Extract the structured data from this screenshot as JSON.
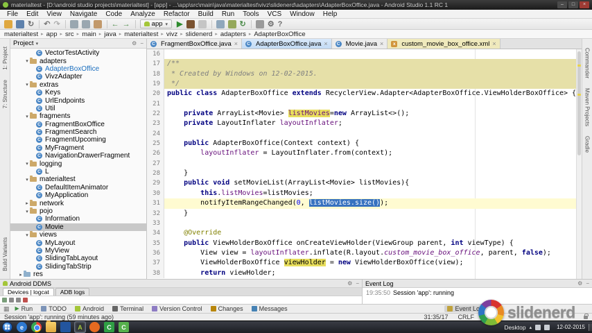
{
  "window": {
    "title": "materialtest - [D:\\android studio projects\\materialtest] - [app] - ...\\app\\src\\main\\java\\materialtest\\vivz\\slidenerd\\adapters\\AdapterBoxOffice.java - Android Studio 1.1 RC 1",
    "controls": {
      "minimize": "–",
      "maximize": "□",
      "close": "×"
    }
  },
  "menu_bar": {
    "items": [
      "File",
      "Edit",
      "View",
      "Navigate",
      "Code",
      "Analyze",
      "Refactor",
      "Build",
      "Run",
      "Tools",
      "VCS",
      "Window",
      "Help"
    ]
  },
  "toolbar": {
    "run_config": "app",
    "left_icons": [
      {
        "name": "open-icon",
        "color": "#DFA840"
      },
      {
        "name": "save-all-icon",
        "color": "#5E81AC"
      },
      {
        "name": "sync-icon",
        "glyph": "↻",
        "color": "#6E6E6E"
      },
      {
        "sep": true
      },
      {
        "name": "undo-icon",
        "glyph": "↶",
        "color": "#7A7A7A"
      },
      {
        "name": "redo-icon",
        "glyph": "↷",
        "color": "#B0B0B0"
      },
      {
        "sep": true
      },
      {
        "name": "cut-icon",
        "color": "#9AA7B0"
      },
      {
        "name": "copy-icon",
        "color": "#9AA7B0"
      },
      {
        "name": "paste-icon",
        "color": "#C2996B"
      },
      {
        "sep": true
      },
      {
        "name": "back-icon",
        "glyph": "←",
        "color": "#4C8C4A"
      },
      {
        "name": "forward-icon",
        "glyph": "→",
        "color": "#4C8C4A"
      },
      {
        "sep": true
      }
    ],
    "right_icons": [
      {
        "name": "run-icon",
        "glyph": "▶",
        "color": "#2E8B2E"
      },
      {
        "name": "debug-icon",
        "color": "#7A5230"
      },
      {
        "name": "stop-icon",
        "color": "#C5C5C5"
      },
      {
        "sep": true
      },
      {
        "name": "avd-manager-icon",
        "color": "#8FA7BC"
      },
      {
        "name": "sdk-manager-icon",
        "color": "#95A85C"
      },
      {
        "name": "gradle-sync-icon",
        "glyph": "↻",
        "color": "#4C8C4A"
      },
      {
        "sep": true
      },
      {
        "name": "project-structure-icon",
        "color": "#9A9A9A"
      },
      {
        "name": "settings-icon",
        "glyph": "⚙",
        "color": "#6E6E6E"
      },
      {
        "name": "help-icon",
        "glyph": "?",
        "color": "#6E6E6E"
      }
    ]
  },
  "breadcrumbs": {
    "items": [
      "materialtest",
      "app",
      "src",
      "main",
      "java",
      "materialtest",
      "vivz",
      "slidenerd",
      "adapters",
      "AdapterBoxOffice"
    ]
  },
  "side_stripes": {
    "left_top": [
      "1: Project",
      "7: Structure"
    ],
    "left_bottom": [
      "Build Variants"
    ],
    "right": [
      "Commander",
      "Maven Projects",
      "Gradle"
    ]
  },
  "project": {
    "title": "Project",
    "items": [
      {
        "label": "VectorTestActivity",
        "depth": 3,
        "icon": "class"
      },
      {
        "label": "adapters",
        "depth": 2,
        "icon": "package",
        "arrow": "down"
      },
      {
        "label": "AdapterBoxOffice",
        "depth": 3,
        "icon": "class",
        "accent": true
      },
      {
        "label": "VivzAdapter",
        "depth": 3,
        "icon": "class"
      },
      {
        "label": "extras",
        "depth": 2,
        "icon": "package",
        "arrow": "down"
      },
      {
        "label": "Keys",
        "depth": 3,
        "icon": "class"
      },
      {
        "label": "UrlEndpoints",
        "depth": 3,
        "icon": "class"
      },
      {
        "label": "Util",
        "depth": 3,
        "icon": "class"
      },
      {
        "label": "fragments",
        "depth": 2,
        "icon": "package",
        "arrow": "down"
      },
      {
        "label": "FragmentBoxOffice",
        "depth": 3,
        "icon": "class"
      },
      {
        "label": "FragmentSearch",
        "depth": 3,
        "icon": "class"
      },
      {
        "label": "FragmentUpcoming",
        "depth": 3,
        "icon": "class"
      },
      {
        "label": "MyFragment",
        "depth": 3,
        "icon": "class"
      },
      {
        "label": "NavigationDrawerFragment",
        "depth": 3,
        "icon": "class"
      },
      {
        "label": "logging",
        "depth": 2,
        "icon": "package",
        "arrow": "down"
      },
      {
        "label": "L",
        "depth": 3,
        "icon": "class"
      },
      {
        "label": "materialtest",
        "depth": 2,
        "icon": "package",
        "arrow": "down"
      },
      {
        "label": "DefaultItemAnimator",
        "depth": 3,
        "icon": "class"
      },
      {
        "label": "MyApplication",
        "depth": 3,
        "icon": "class"
      },
      {
        "label": "network",
        "depth": 2,
        "icon": "package",
        "arrow": "right"
      },
      {
        "label": "pojo",
        "depth": 2,
        "icon": "package",
        "arrow": "down"
      },
      {
        "label": "Information",
        "depth": 3,
        "icon": "class"
      },
      {
        "label": "Movie",
        "depth": 3,
        "icon": "class",
        "selected": true
      },
      {
        "label": "views",
        "depth": 2,
        "icon": "package",
        "arrow": "down"
      },
      {
        "label": "MyLayout",
        "depth": 3,
        "icon": "class"
      },
      {
        "label": "MyView",
        "depth": 3,
        "icon": "class"
      },
      {
        "label": "SlidingTabLayout",
        "depth": 3,
        "icon": "class"
      },
      {
        "label": "SlidingTabStrip",
        "depth": 3,
        "icon": "class"
      },
      {
        "label": "res",
        "depth": 1,
        "icon": "folder",
        "arrow": "right"
      }
    ]
  },
  "editor": {
    "tabs": [
      {
        "label": "FragmentBoxOffice.java",
        "icon": "java"
      },
      {
        "label": "AdapterBoxOffice.java",
        "icon": "java",
        "state": "active"
      },
      {
        "label": "Movie.java",
        "icon": "java"
      },
      {
        "label": "custom_movie_box_office.xml",
        "icon": "xml",
        "state": "tinted"
      }
    ],
    "lines": [
      {
        "n": 16,
        "segs": []
      },
      {
        "n": 17,
        "bg": "cmt",
        "segs": [
          [
            "c",
            "/**"
          ]
        ]
      },
      {
        "n": 18,
        "bg": "cmt",
        "segs": [
          [
            "c",
            " * Created by Windows on 12-02-2015."
          ]
        ]
      },
      {
        "n": 19,
        "bg": "cmt",
        "segs": [
          [
            "c",
            " */"
          ]
        ]
      },
      {
        "n": 20,
        "segs": [
          [
            "k",
            "public class "
          ],
          [
            "p",
            "AdapterBoxOffice "
          ],
          [
            "k",
            "extends "
          ],
          [
            "p",
            "RecyclerView.Adapter<AdapterBoxOffice.ViewHolderBoxOffice> {"
          ]
        ]
      },
      {
        "n": 21,
        "segs": []
      },
      {
        "n": 22,
        "segs": [
          [
            "p",
            "    "
          ],
          [
            "k",
            "private "
          ],
          [
            "p",
            "ArrayList<Movie> "
          ],
          [
            "fh",
            "listMovies"
          ],
          [
            "p",
            "="
          ],
          [
            "k",
            "new "
          ],
          [
            "p",
            "ArrayList<>();"
          ]
        ]
      },
      {
        "n": 23,
        "segs": [
          [
            "p",
            "    "
          ],
          [
            "k",
            "private "
          ],
          [
            "p",
            "LayoutInflater "
          ],
          [
            "f",
            "layoutInflater"
          ],
          [
            "p",
            ";"
          ]
        ]
      },
      {
        "n": 24,
        "segs": []
      },
      {
        "n": 25,
        "segs": [
          [
            "p",
            "    "
          ],
          [
            "k",
            "public "
          ],
          [
            "p",
            "AdapterBoxOffice(Context context) {"
          ]
        ]
      },
      {
        "n": 26,
        "segs": [
          [
            "p",
            "        "
          ],
          [
            "f",
            "layoutInflater"
          ],
          [
            "p",
            " = LayoutInflater.from(context);"
          ]
        ]
      },
      {
        "n": 27,
        "segs": []
      },
      {
        "n": 28,
        "segs": [
          [
            "p",
            "    }"
          ]
        ]
      },
      {
        "n": 29,
        "segs": [
          [
            "p",
            "    "
          ],
          [
            "k",
            "public void "
          ],
          [
            "p",
            "setMovieList(ArrayList<Movie> listMovies){"
          ]
        ]
      },
      {
        "n": 30,
        "segs": [
          [
            "p",
            "        "
          ],
          [
            "k",
            "this"
          ],
          [
            "p",
            "."
          ],
          [
            "f",
            "listMovies"
          ],
          [
            "p",
            "=listMovies;"
          ]
        ]
      },
      {
        "n": 31,
        "bg": "cur",
        "segs": [
          [
            "p",
            "        notifyItemRangeChanged("
          ],
          [
            "n",
            "0"
          ],
          [
            "p",
            ", "
          ],
          [
            "s",
            "listMovies.size()"
          ],
          [
            "p",
            ");"
          ]
        ]
      },
      {
        "n": 32,
        "segs": [
          [
            "p",
            "    }"
          ]
        ]
      },
      {
        "n": 33,
        "segs": []
      },
      {
        "n": 34,
        "segs": [
          [
            "p",
            "    "
          ],
          [
            "a",
            "@Override"
          ]
        ]
      },
      {
        "n": 35,
        "segs": [
          [
            "p",
            "    "
          ],
          [
            "k",
            "public "
          ],
          [
            "p",
            "ViewHolderBoxOffice onCreateViewHolder(ViewGroup parent, "
          ],
          [
            "k",
            "int "
          ],
          [
            "p",
            "viewType) {"
          ]
        ]
      },
      {
        "n": 36,
        "segs": [
          [
            "p",
            "        View view = "
          ],
          [
            "f",
            "layoutInflater"
          ],
          [
            "p",
            ".inflate(R.layout."
          ],
          [
            "r",
            "custom_movie_box_office"
          ],
          [
            "p",
            ", parent, "
          ],
          [
            "k",
            "false"
          ],
          [
            "p",
            ");"
          ]
        ]
      },
      {
        "n": 37,
        "segs": [
          [
            "p",
            "        ViewHolderBoxOffice "
          ],
          [
            "vh",
            "viewHolder"
          ],
          [
            "p",
            " = "
          ],
          [
            "k",
            "new "
          ],
          [
            "p",
            "ViewHolderBoxOffice(view);"
          ]
        ]
      },
      {
        "n": 38,
        "segs": [
          [
            "p",
            "        "
          ],
          [
            "k",
            "return "
          ],
          [
            "p",
            "viewHolder;"
          ]
        ]
      }
    ]
  },
  "ddms": {
    "title": "Android DDMS",
    "tabs": [
      {
        "label": "Devices | logcat",
        "active": true
      },
      {
        "label": "ADB logs",
        "active": false
      }
    ],
    "strip_icons": [
      {
        "name": "screen-capture-icon",
        "color": "#7A9E7A"
      },
      {
        "name": "video-capture-icon",
        "color": "#8A8A8A"
      },
      {
        "name": "layout-inspector-icon",
        "color": "#8A8A8A"
      },
      {
        "name": "terminate-icon",
        "color": "#C0504D"
      }
    ]
  },
  "event_log": {
    "title": "Event Log",
    "entries": [
      {
        "time": "19:35:50",
        "text": "Session 'app': running"
      }
    ]
  },
  "tool_buttons": {
    "left": [
      {
        "label": "Run",
        "glyph": "▶",
        "color": "#3E8E41"
      },
      {
        "label": "TODO",
        "color": "#7D94B8"
      },
      {
        "label": "Android",
        "color": "#A4C639"
      },
      {
        "label": "Terminal",
        "color": "#666666"
      },
      {
        "label": "Version Control",
        "color": "#8E7CC3"
      },
      {
        "label": "Changes",
        "color": "#B8860B"
      },
      {
        "label": "Messages",
        "color": "#4682B4"
      }
    ],
    "right": [
      {
        "label": "Event Log",
        "color": "#C0A23C"
      }
    ]
  },
  "status_bar": {
    "message": "Session 'app': running (59 minutes ago)",
    "right": [
      "31:35/17",
      "CRLF"
    ]
  },
  "taskbar": {
    "desktop_label": "Desktop",
    "date": "12-02-2015",
    "icons": [
      {
        "name": "internet-explorer-icon",
        "shape": "circle",
        "bg": "#2E79D0",
        "glyph": "e"
      },
      {
        "name": "chrome-icon",
        "shape": "chrome"
      },
      {
        "name": "file-explorer-icon",
        "shape": "tfolder"
      },
      {
        "name": "blue-app-icon",
        "shape": "sq",
        "bg": "#23559E"
      },
      {
        "name": "android-studio-icon",
        "shape": "sq",
        "bg": "#30343B",
        "glyph": "A",
        "fg": "#A4C639",
        "active": true
      },
      {
        "name": "firefox-icon",
        "shape": "circle",
        "bg": "#E66A20"
      },
      {
        "name": "green-app-icon-1",
        "shape": "sq",
        "bg": "#2F9E44",
        "glyph": "C"
      },
      {
        "name": "green-app-icon-2",
        "shape": "sq",
        "bg": "#56B04C",
        "glyph": "C"
      }
    ]
  },
  "watermark": {
    "text": "slidenerd"
  }
}
